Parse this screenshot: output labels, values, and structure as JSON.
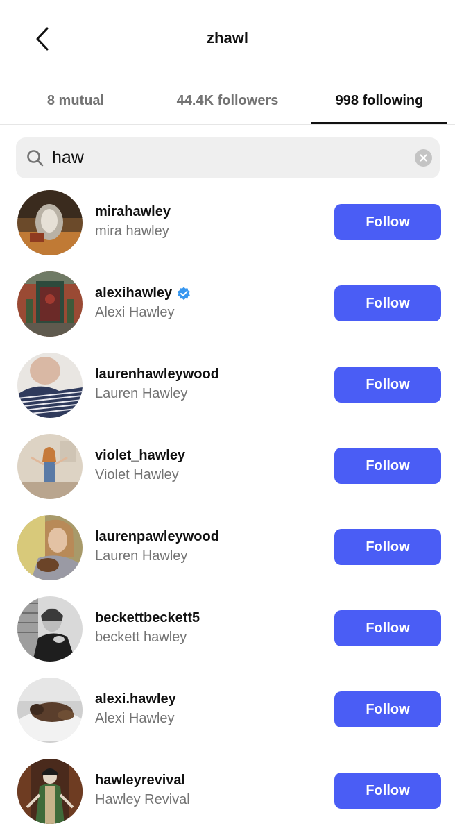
{
  "header": {
    "title": "zhawl",
    "back_icon": "chevron-left-icon"
  },
  "tabs": [
    {
      "label": "8 mutual",
      "active": false
    },
    {
      "label": "44.4K followers",
      "active": false
    },
    {
      "label": "998 following",
      "active": true
    }
  ],
  "search": {
    "value": "haw",
    "icon": "search-icon",
    "clear_icon": "clear-icon"
  },
  "users": [
    {
      "username": "mirahawley",
      "name": "mira hawley",
      "verified": false,
      "button": "Follow"
    },
    {
      "username": "alexihawley",
      "name": "Alexi Hawley",
      "verified": true,
      "button": "Follow"
    },
    {
      "username": "laurenhawleywood",
      "name": "Lauren Hawley",
      "verified": false,
      "button": "Follow"
    },
    {
      "username": "violet_hawley",
      "name": "Violet Hawley",
      "verified": false,
      "button": "Follow"
    },
    {
      "username": "laurenpawleywood",
      "name": "Lauren Hawley",
      "verified": false,
      "button": "Follow"
    },
    {
      "username": "beckettbeckett5",
      "name": "beckett hawley",
      "verified": false,
      "button": "Follow"
    },
    {
      "username": "alexi.hawley",
      "name": "Alexi Hawley",
      "verified": false,
      "button": "Follow"
    },
    {
      "username": "hawleyrevival",
      "name": "Hawley Revival",
      "verified": false,
      "button": "Follow"
    }
  ],
  "colors": {
    "follow_button": "#4a5df5",
    "verified_badge": "#3797f0",
    "secondary_text": "#737373"
  }
}
